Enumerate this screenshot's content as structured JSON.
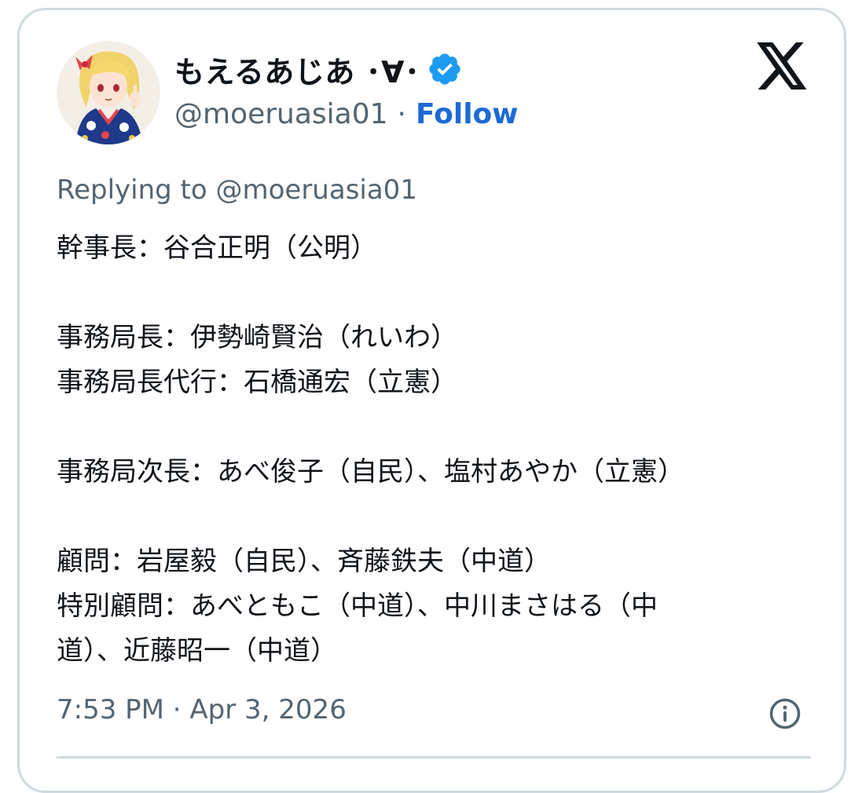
{
  "author": {
    "display_name": "もえるあじあ ･∀･",
    "handle": "@moeruasia01",
    "separator": "·",
    "follow_label": "Follow",
    "verified": true,
    "avatar_icon": "anime-girl-avatar",
    "badge_icon": "verified-badge-icon"
  },
  "brand": {
    "logo_icon": "x-logo-icon",
    "accent_color": "#1d6ad6",
    "badge_color": "#1d9bf0"
  },
  "reply_to": "Replying to @moeruasia01",
  "body": {
    "lines": [
      "幹事長：谷合正明（公明）",
      "",
      "事務局長：伊勢崎賢治（れいわ）",
      "事務局長代行：石橋通宏（立憲）",
      "",
      "事務局次長：あべ俊子（自民）、塩村あやか（立憲）",
      "",
      "顧問：岩屋毅（自民）、斉藤鉄夫（中道）",
      "特別顧問：あべともこ（中道）、中川まさはる（中",
      "道）、近藤昭一（中道）"
    ]
  },
  "timestamp": "7:53 PM · Apr 3, 2026",
  "info_icon": "info-icon"
}
